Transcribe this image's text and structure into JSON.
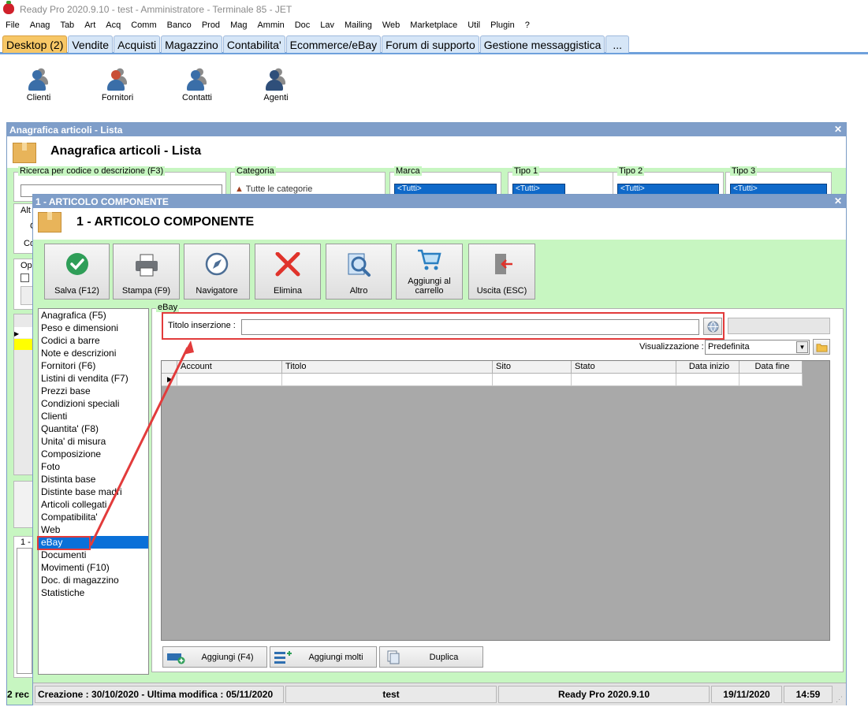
{
  "window": {
    "title": "Ready Pro 2020.9.10 - test - Amministratore - Terminale 85 - JET"
  },
  "menu": [
    "File",
    "Anag",
    "Tab",
    "Art",
    "Acq",
    "Comm",
    "Banco",
    "Prod",
    "Mag",
    "Ammin",
    "Doc",
    "Lav",
    "Mailing",
    "Web",
    "Marketplace",
    "Util",
    "Plugin",
    "?"
  ],
  "tabs": [
    "Desktop (2)",
    "Vendite",
    "Acquisti",
    "Magazzino",
    "Contabilita'",
    "Ecommerce/eBay",
    "Forum di supporto",
    "Gestione messaggistica",
    "..."
  ],
  "desktop_icons": [
    {
      "label": "Clienti",
      "icon": "clienti-icon"
    },
    {
      "label": "Fornitori",
      "icon": "fornitori-icon"
    },
    {
      "label": "Contatti",
      "icon": "contatti-icon"
    },
    {
      "label": "Agenti",
      "icon": "agenti-icon"
    }
  ],
  "back_window": {
    "title": "Anagrafica articoli  - Lista",
    "header": "Anagrafica articoli  - Lista",
    "search_label": "Ricerca per codice o descrizione (F3)",
    "categoria_label": "Categoria",
    "categoria_value": "Tutte le categorie",
    "marca_label": "Marca",
    "tipo1_label": "Tipo 1",
    "tipo2_label": "Tipo 2",
    "tipo3_label": "Tipo 3",
    "tutti": "<Tutti>",
    "frag_alt": "Alt",
    "frag_op": "Op",
    "frag_c": "C",
    "frag_co": "Co",
    "frag_1": "1 -",
    "status_left": "2 rec"
  },
  "front_window": {
    "title": "1 - ARTICOLO COMPONENTE",
    "header": "1 - ARTICOLO COMPONENTE",
    "toolbar": [
      {
        "label": "Salva (F12)"
      },
      {
        "label": "Stampa (F9)"
      },
      {
        "label": "Navigatore"
      },
      {
        "label": "Elimina"
      },
      {
        "label": "Altro"
      },
      {
        "label": "Aggiungi al carrello"
      },
      {
        "label": "Uscita (ESC)"
      }
    ],
    "sections": [
      "Anagrafica (F5)",
      "Peso e dimensioni",
      "Codici a barre",
      "Note e descrizioni",
      "Fornitori (F6)",
      "Listini di vendita (F7)",
      "Prezzi base",
      "Condizioni speciali",
      "Clienti",
      "Quantita' (F8)",
      "Unita' di misura",
      "Composizione",
      "Foto",
      "Distinta base",
      "Distinte base madri",
      "Articoli collegati",
      "Compatibilita'",
      "Web",
      "eBay",
      "Documenti",
      "Movimenti (F10)",
      "Doc. di magazzino",
      "Statistiche"
    ],
    "selected_section": "eBay",
    "ebay": {
      "group_label": "eBay",
      "titolo_label": "Titolo inserzione :",
      "titolo_value": "",
      "visualizzazione_label": "Visualizzazione :",
      "visualizzazione_value": "Predefinita",
      "columns": [
        "Account",
        "Titolo",
        "Sito",
        "Stato",
        "Data inizio",
        "Data fine"
      ],
      "buttons": [
        {
          "label": "Aggiungi (F4)"
        },
        {
          "label": "Aggiungi molti"
        },
        {
          "label": "Duplica"
        }
      ]
    },
    "status": {
      "created": "Creazione : 30/10/2020 - Ultima modifica : 05/11/2020",
      "user": "test",
      "version": "Ready Pro 2020.9.10",
      "date": "19/11/2020",
      "time": "14:59"
    }
  },
  "colors": {
    "accent_green": "#c7f6c1",
    "selection_blue": "#0a70d8",
    "annotation_red": "#e23b3b",
    "tab_active": "#f7c766"
  }
}
